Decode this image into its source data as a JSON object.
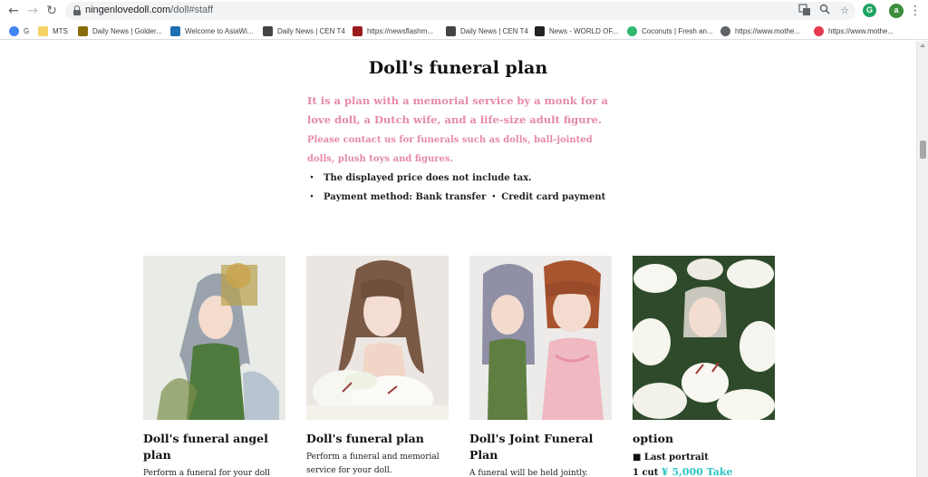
{
  "browser": {
    "url_host": "ningenlovedoll.com",
    "url_path": "/doll#staff",
    "profile_initial": "a",
    "ext_initial": "G",
    "bookmarks": [
      {
        "label": "G",
        "color": "#4285f4",
        "circle": true
      },
      {
        "label": "MTS",
        "color": "#f6d365",
        "circle": false
      },
      {
        "label": "Daily News | Golder...",
        "color": "#8a6d0b",
        "circle": false
      },
      {
        "label": "Welcome to AsiaWi...",
        "color": "#1f6fb2",
        "circle": false
      },
      {
        "label": "Daily News | CEN T4",
        "color": "#444444",
        "circle": false
      },
      {
        "label": "https://newsflashm...",
        "color": "#9b1c1c",
        "circle": false
      },
      {
        "label": "Daily News | CEN T4",
        "color": "#444444",
        "circle": false
      },
      {
        "label": "News - WORLD OF...",
        "color": "#222222",
        "circle": false
      },
      {
        "label": "Coconuts | Fresh an...",
        "color": "#2fb86e",
        "circle": true
      },
      {
        "label": "https://www.mothe...",
        "color": "#5f6368",
        "circle": true
      },
      {
        "label": "https://www.mothe...",
        "color": "#e53950",
        "circle": true
      }
    ]
  },
  "page": {
    "title": "Doll's funeral plan",
    "intro_line1": "It is a plan with a memorial service by a monk for a",
    "intro_line2": "love doll, a Dutch wife, and a life-size adult figure.",
    "contact_line1": "Please contact us for funerals such as dolls, ball-jointed",
    "contact_line2": "dolls, plush toys and figures.",
    "note_dot": "・",
    "note_tax": "The displayed price does not include tax.",
    "note_payment": "Payment method: Bank transfer ・ Credit card payment"
  },
  "cards": [
    {
      "heading": "Doll's funeral angel plan",
      "desc": "Perform a funeral for your doll and"
    },
    {
      "heading": "Doll's funeral plan",
      "desc": "Perform a funeral and memorial service for your doll."
    },
    {
      "heading": "Doll's Joint Funeral Plan",
      "desc": "A funeral will be held jointly."
    },
    {
      "heading": "option",
      "option_item": "■ Last portrait",
      "option_prefix": "1 cut",
      "option_price": "¥ 5,000 Take"
    }
  ],
  "colors": {
    "pink_text": "#e58aa4",
    "price_teal": "#2ec4c7"
  }
}
